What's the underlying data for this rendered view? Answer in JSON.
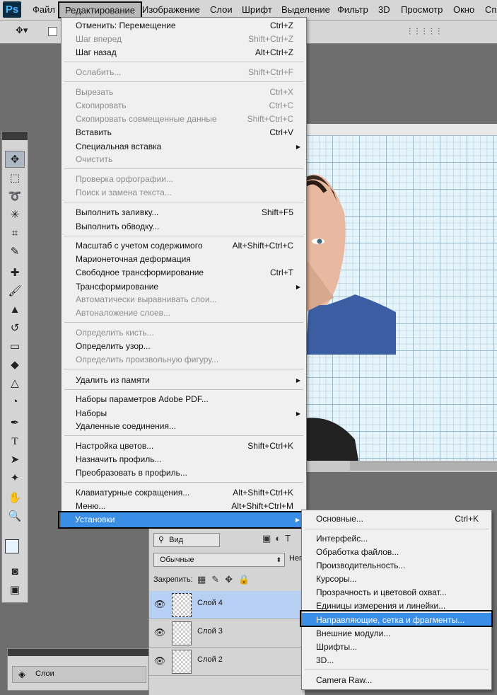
{
  "app": {
    "logo": "Ps"
  },
  "menubar": {
    "items": [
      "Файл",
      "Редактирование",
      "Изображение",
      "Слои",
      "Шрифт",
      "Выделение",
      "Фильтр",
      "3D",
      "Просмотр",
      "Окно",
      "Спр"
    ]
  },
  "edit_menu": {
    "items": [
      {
        "label": "Отменить: Перемещение",
        "shortcut": "Ctrl+Z",
        "enabled": true
      },
      {
        "label": "Шаг вперед",
        "shortcut": "Shift+Ctrl+Z",
        "enabled": false
      },
      {
        "label": "Шаг назад",
        "shortcut": "Alt+Ctrl+Z",
        "enabled": true
      },
      {
        "label": "Ослабить...",
        "shortcut": "Shift+Ctrl+F",
        "enabled": false
      },
      {
        "label": "Вырезать",
        "shortcut": "Ctrl+X",
        "enabled": false
      },
      {
        "label": "Скопировать",
        "shortcut": "Ctrl+C",
        "enabled": false
      },
      {
        "label": "Скопировать совмещенные данные",
        "shortcut": "Shift+Ctrl+C",
        "enabled": false
      },
      {
        "label": "Вставить",
        "shortcut": "Ctrl+V",
        "enabled": true
      },
      {
        "label": "Специальная вставка",
        "shortcut": "",
        "enabled": true
      },
      {
        "label": "Очистить",
        "shortcut": "",
        "enabled": false
      },
      {
        "label": "Проверка орфографии...",
        "shortcut": "",
        "enabled": false
      },
      {
        "label": "Поиск и замена текста...",
        "shortcut": "",
        "enabled": false
      },
      {
        "label": "Выполнить заливку...",
        "shortcut": "Shift+F5",
        "enabled": true
      },
      {
        "label": "Выполнить обводку...",
        "shortcut": "",
        "enabled": true
      },
      {
        "label": "Масштаб с учетом содержимого",
        "shortcut": "Alt+Shift+Ctrl+C",
        "enabled": true
      },
      {
        "label": "Марионеточная деформация",
        "shortcut": "",
        "enabled": true
      },
      {
        "label": "Свободное трансформирование",
        "shortcut": "Ctrl+T",
        "enabled": true
      },
      {
        "label": "Трансформирование",
        "shortcut": "",
        "enabled": true
      },
      {
        "label": "Автоматически выравнивать слои...",
        "shortcut": "",
        "enabled": false
      },
      {
        "label": "Автоналожение слоев...",
        "shortcut": "",
        "enabled": false
      },
      {
        "label": "Определить кисть...",
        "shortcut": "",
        "enabled": false
      },
      {
        "label": "Определить узор...",
        "shortcut": "",
        "enabled": true
      },
      {
        "label": "Определить произвольную фигуру...",
        "shortcut": "",
        "enabled": false
      },
      {
        "label": "Удалить из памяти",
        "shortcut": "",
        "enabled": true
      },
      {
        "label": "Наборы параметров Adobe PDF...",
        "shortcut": "",
        "enabled": true
      },
      {
        "label": "Наборы",
        "shortcut": "",
        "enabled": true
      },
      {
        "label": "Удаленные соединения...",
        "shortcut": "",
        "enabled": true
      },
      {
        "label": "Настройка цветов...",
        "shortcut": "Shift+Ctrl+K",
        "enabled": true
      },
      {
        "label": "Назначить профиль...",
        "shortcut": "",
        "enabled": true
      },
      {
        "label": "Преобразовать в профиль...",
        "shortcut": "",
        "enabled": true
      },
      {
        "label": "Клавиатурные сокращения...",
        "shortcut": "Alt+Shift+Ctrl+K",
        "enabled": true
      },
      {
        "label": "Меню...",
        "shortcut": "Alt+Shift+Ctrl+M",
        "enabled": true
      },
      {
        "label": "Установки",
        "shortcut": "",
        "enabled": true
      }
    ]
  },
  "sub_menu": {
    "items": [
      {
        "label": "Основные...",
        "shortcut": "Ctrl+K"
      },
      {
        "label": "Интерфейс...",
        "shortcut": ""
      },
      {
        "label": "Обработка файлов...",
        "shortcut": ""
      },
      {
        "label": "Производительность...",
        "shortcut": ""
      },
      {
        "label": "Курсоры...",
        "shortcut": ""
      },
      {
        "label": "Прозрачность и цветовой охват...",
        "shortcut": ""
      },
      {
        "label": "Единицы измерения и линейки...",
        "shortcut": ""
      },
      {
        "label": "Направляющие, сетка и фрагменты...",
        "shortcut": ""
      },
      {
        "label": "Внешние модули...",
        "shortcut": ""
      },
      {
        "label": "Шрифты...",
        "shortcut": ""
      },
      {
        "label": "3D...",
        "shortcut": ""
      },
      {
        "label": "Camera Raw...",
        "shortcut": ""
      }
    ]
  },
  "layers_panel": {
    "filter_label": "Вид",
    "blend_mode": "Обычные",
    "opacity_label": "Неп",
    "lock_label": "Закрепить:",
    "layers": [
      "Слой 4",
      "Слой 3",
      "Слой 2"
    ]
  },
  "layers_mini": {
    "tab_label": "Слои"
  },
  "colors": {
    "accent": "#3a8ee6",
    "selected_layer": "#b7cff2"
  }
}
